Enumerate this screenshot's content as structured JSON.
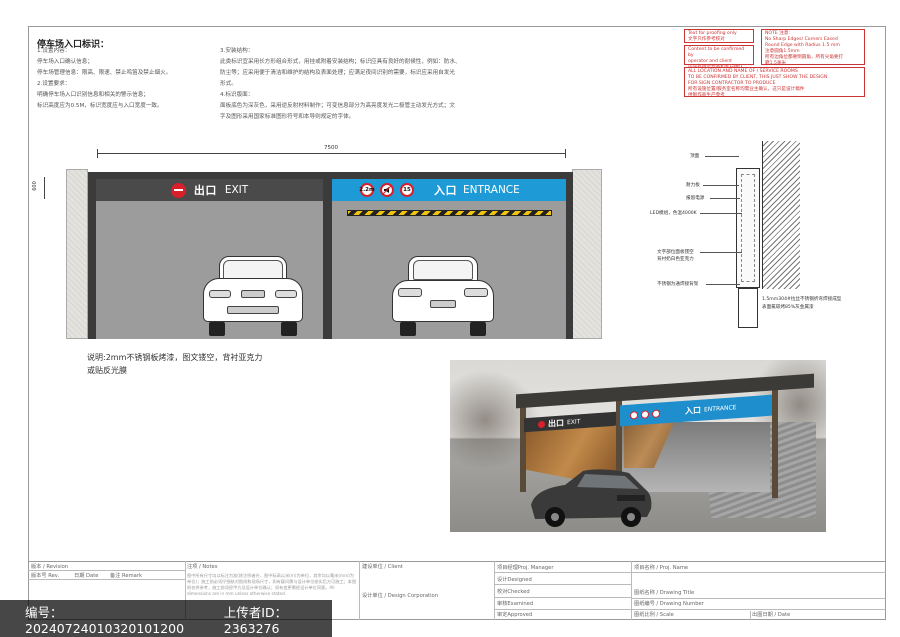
{
  "notes": {
    "title": "停车场入口标识：",
    "left": [
      "1.设置内容：",
      "停车场入口确认信息；",
      "停车场管理信息：限高、限速、禁止鸣笛及禁止烟火。",
      "2.设置要求：",
      "明确停车场入口识别信息和相关的警示信息；",
      "标识高度应为0.5M，标识宽度应与入口宽度一致。"
    ],
    "mid": [
      "3.安装结构：",
      "此类标识宜采用长方形组合形式，用挂或附着安装结构；标识应具有良好的耐候性，例如：防水、",
      "防尘等；应采用便于清洁和维护的结构及表面处理；应满足夜间识别的需要，标识应采用自发光",
      "形式。",
      "4.标识版面：",
      "面板底色为深灰色，采用逆反射材料制作；可变信息部分为高亮度发光二极管主动发光方式；文",
      "字及图形采用国家标准图形符号和本导则规定的字体。"
    ]
  },
  "stamps": {
    "s1": [
      "Text for proofing only",
      "文字只作参考校对"
    ],
    "s2": [
      "Content to be confirmed by",
      "operator and client",
      "内容有待运营商和客户确认"
    ],
    "s3": [
      "NOTE 注意:",
      "No Sharp Edges/ Corners Eased",
      "Round Edge with Radius 1.5 mm",
      "注意圆角1.5mm",
      "所有边角位都要倒圆角，所有尖角要打",
      "磨1.5毫米"
    ],
    "s4": [
      "ALL LOCATION AND NAME OF / SERVICE ROOMS",
      "TO BE CONFIRMED BY CLIENT, THIS JUST SHOW THE DESIGN",
      "FOR SIGN CONTRACTOR TO PRODUCE",
      "所有设施位置/服务室名称均需业主确认，这只是设计稿件",
      "供制作商生产参考"
    ]
  },
  "elevation": {
    "width_dim": "7500",
    "height_dim": "600",
    "exit_cn": "出口",
    "exit_en": "EXIT",
    "entrance_cn": "入口",
    "entrance_en": "ENTRANCE",
    "ban_signs": [
      "2.2m",
      "",
      "15"
    ]
  },
  "caption": [
    "说明:2mm不锈钢板烤漆，图文镂空，背衬亚克力",
    "或贴反光膜"
  ],
  "detail": {
    "callouts": [
      "顶面",
      "耐力板",
      "报留电源",
      "LED模组，色温4000K",
      "文字部位面板镂空",
      "背衬奶白色亚克力",
      "不锈钢为通焊接背架",
      "1.5mm304#拉丝不锈钢折弯焊接成型",
      "表面氟碳烤85%灰金属漆"
    ]
  },
  "render": {
    "exit_cn": "出口",
    "exit_en": "EXIT",
    "entrance_cn": "入口",
    "entrance_en": "ENTRANCE"
  },
  "title_block": {
    "revision": "版本 / Revision",
    "rev_no": "版本号 Rev.",
    "date": "日期 Date",
    "remark": "备注 Remark",
    "notes": "注项 / Notes",
    "notes_body": "图中所有尺寸均以标注为准(除注明者外，图中标高以米(m)为单位，其余均以毫米(mm)为单位)；施工前必须仔细核对图纸和现场尺寸，如有疑问需与设计单位核实后方可施工；本图纸仅供参考，施工前须经甲方及设计单位确认；如有变更需经设计单位同意。All dimensions are in mm unless otherwise stated.",
    "client": "建设单位 / Client",
    "design_corp": "设计单位 / Design Corporation",
    "manager": "项目经理Proj. Manager",
    "designed": "设计Designed",
    "checked": "校对Checked",
    "examined": "审核Examined",
    "approved": "审定Approved",
    "proj_name": "项目名称 / Proj. Name",
    "drawing_title": "图纸名称 / Drawing Title",
    "drawing_number": "图纸编号 / Drawing Number",
    "scale": "图纸比例 / Scale",
    "date2": "出图日期 / Date"
  },
  "watermark": {
    "id_label": "编号：",
    "id": "20240724010320101200",
    "uploader_label": "上传者ID：",
    "uploader": "2363276"
  }
}
